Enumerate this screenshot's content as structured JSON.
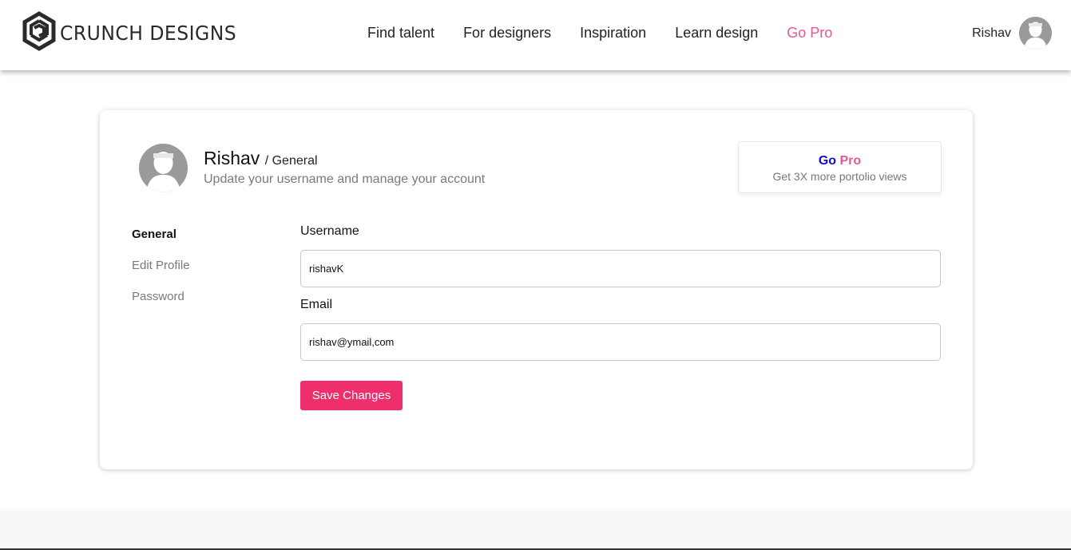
{
  "brand": {
    "name": "CRUNCH DESIGNS"
  },
  "nav": {
    "items": [
      {
        "label": "Find talent"
      },
      {
        "label": "For designers"
      },
      {
        "label": "Inspiration"
      },
      {
        "label": "Learn design"
      },
      {
        "label": "Go Pro"
      }
    ],
    "pro_color": "#e8569a"
  },
  "user": {
    "name": "Rishav",
    "icon": "user-avatar-icon"
  },
  "profile": {
    "name": "Rishav",
    "section": "/ General",
    "subtitle": "Update your username and manage your account"
  },
  "gopro_card": {
    "go": "Go",
    "pro": "Pro",
    "subtitle": "Get 3X more portolio views",
    "go_color": "#1010b8",
    "pro_color": "#e8569a"
  },
  "side_menu": {
    "items": [
      {
        "label": "General",
        "active": true
      },
      {
        "label": "Edit Profile",
        "active": false
      },
      {
        "label": "Password",
        "active": false
      }
    ]
  },
  "form": {
    "username_label": "Username",
    "username_value": "rishavK",
    "email_label": "Email",
    "email_value": "rishav@ymail,com",
    "save_label": "Save Changes",
    "save_color": "#ef2e6c"
  }
}
